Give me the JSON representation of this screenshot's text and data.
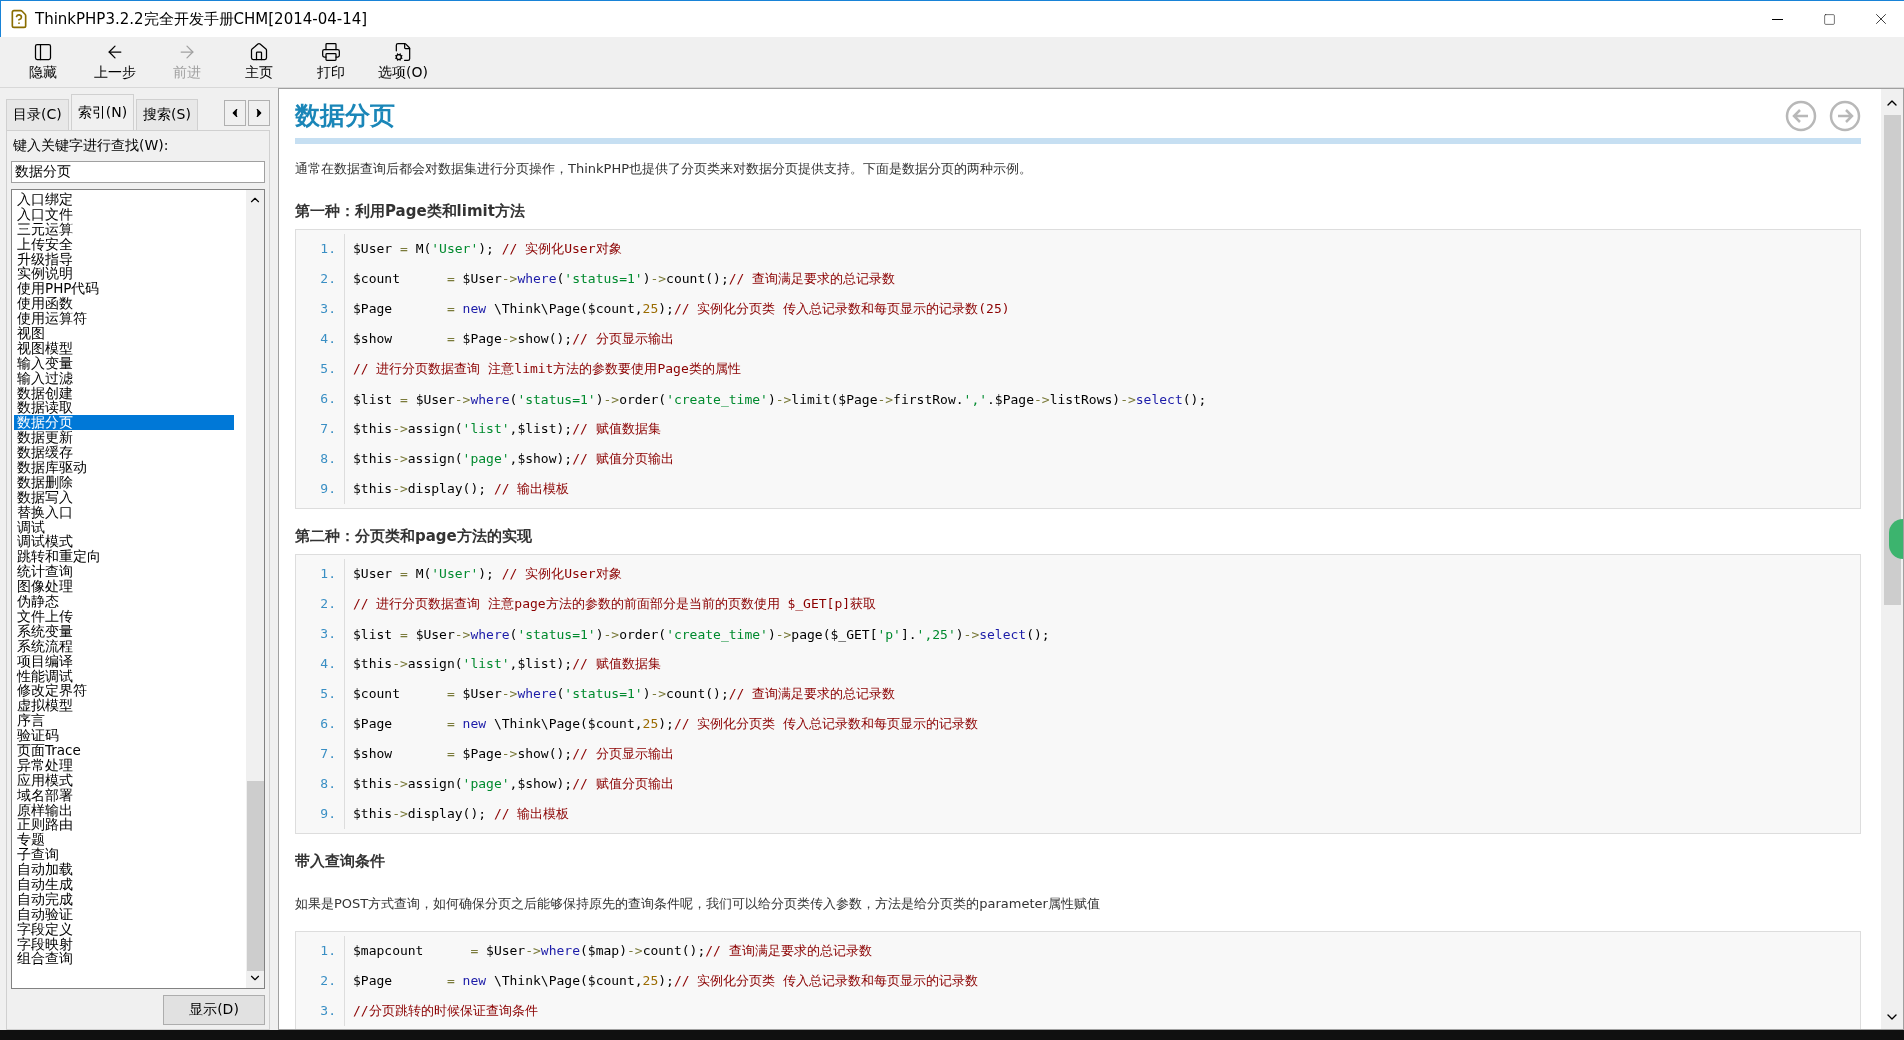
{
  "window": {
    "title": "ThinkPHP3.2.2完全开发手册CHM[2014-04-14]"
  },
  "toolbar": [
    {
      "kind": "hide",
      "label": "隐藏",
      "disabled": false
    },
    {
      "kind": "back",
      "label": "上一步",
      "disabled": false
    },
    {
      "kind": "forward",
      "label": "前进",
      "disabled": true
    },
    {
      "kind": "home",
      "label": "主页",
      "disabled": false
    },
    {
      "kind": "print",
      "label": "打印",
      "disabled": false
    },
    {
      "kind": "options",
      "label": "选项(O)",
      "disabled": false
    }
  ],
  "nav_tabs": [
    {
      "label": "目录(C)",
      "selected": false
    },
    {
      "label": "索引(N)",
      "selected": true
    },
    {
      "label": "搜索(S)",
      "selected": false
    }
  ],
  "index": {
    "prompt": "键入关键字进行查找(W):",
    "value": "数据分页",
    "items": [
      {
        "label": "入口绑定",
        "selected": false
      },
      {
        "label": "入口文件",
        "selected": false
      },
      {
        "label": "三元运算",
        "selected": false
      },
      {
        "label": "上传安全",
        "selected": false
      },
      {
        "label": "升级指导",
        "selected": false
      },
      {
        "label": "实例说明",
        "selected": false
      },
      {
        "label": "使用PHP代码",
        "selected": false
      },
      {
        "label": "使用函数",
        "selected": false
      },
      {
        "label": "使用运算符",
        "selected": false
      },
      {
        "label": "视图",
        "selected": false
      },
      {
        "label": "视图模型",
        "selected": false
      },
      {
        "label": "输入变量",
        "selected": false
      },
      {
        "label": "输入过滤",
        "selected": false
      },
      {
        "label": "数据创建",
        "selected": false
      },
      {
        "label": "数据读取",
        "selected": false
      },
      {
        "label": "数据分页",
        "selected": true
      },
      {
        "label": "数据更新",
        "selected": false
      },
      {
        "label": "数据缓存",
        "selected": false
      },
      {
        "label": "数据库驱动",
        "selected": false
      },
      {
        "label": "数据删除",
        "selected": false
      },
      {
        "label": "数据写入",
        "selected": false
      },
      {
        "label": "替换入口",
        "selected": false
      },
      {
        "label": "调试",
        "selected": false
      },
      {
        "label": "调试模式",
        "selected": false
      },
      {
        "label": "跳转和重定向",
        "selected": false
      },
      {
        "label": "统计查询",
        "selected": false
      },
      {
        "label": "图像处理",
        "selected": false
      },
      {
        "label": "伪静态",
        "selected": false
      },
      {
        "label": "文件上传",
        "selected": false
      },
      {
        "label": "系统变量",
        "selected": false
      },
      {
        "label": "系统流程",
        "selected": false
      },
      {
        "label": "项目编译",
        "selected": false
      },
      {
        "label": "性能调试",
        "selected": false
      },
      {
        "label": "修改定界符",
        "selected": false
      },
      {
        "label": "虚拟模型",
        "selected": false
      },
      {
        "label": "序言",
        "selected": false
      },
      {
        "label": "验证码",
        "selected": false
      },
      {
        "label": "页面Trace",
        "selected": false
      },
      {
        "label": "异常处理",
        "selected": false
      },
      {
        "label": "应用模式",
        "selected": false
      },
      {
        "label": "域名部署",
        "selected": false
      },
      {
        "label": "原样输出",
        "selected": false
      },
      {
        "label": "正则路由",
        "selected": false
      },
      {
        "label": "专题",
        "selected": false
      },
      {
        "label": "子查询",
        "selected": false
      },
      {
        "label": "自动加载",
        "selected": false
      },
      {
        "label": "自动生成",
        "selected": false
      },
      {
        "label": "自动完成",
        "selected": false
      },
      {
        "label": "自动验证",
        "selected": false
      },
      {
        "label": "字段定义",
        "selected": false
      },
      {
        "label": "字段映射",
        "selected": false
      },
      {
        "label": "组合查询",
        "selected": false
      }
    ],
    "button": "显示(D)"
  },
  "article": {
    "title": "数据分页",
    "blocks": [
      {
        "kind": "para",
        "text": "通常在数据查询后都会对数据集进行分页操作，ThinkPHP也提供了分页类来对数据分页提供支持。下面是数据分页的两种示例。"
      },
      {
        "kind": "heading",
        "text": "第一种：利用Page类和limit方法"
      },
      {
        "kind": "code",
        "lines": [
          {
            "n": "1.",
            "tokens": [
              {
                "kind": "p",
                "text": "$User "
              },
              {
                "kind": "o",
                "text": "= "
              },
              {
                "kind": "p",
                "text": "M("
              },
              {
                "kind": "s",
                "text": "'User'"
              },
              {
                "kind": "p",
                "text": "); "
              },
              {
                "kind": "c",
                "text": "// 实例化User对象"
              }
            ]
          },
          {
            "n": "2.",
            "tokens": [
              {
                "kind": "p",
                "text": "$count      "
              },
              {
                "kind": "o",
                "text": "= "
              },
              {
                "kind": "p",
                "text": "$User"
              },
              {
                "kind": "o",
                "text": "->"
              },
              {
                "kind": "k",
                "text": "where"
              },
              {
                "kind": "p",
                "text": "("
              },
              {
                "kind": "s",
                "text": "'status=1'"
              },
              {
                "kind": "p",
                "text": ")"
              },
              {
                "kind": "o",
                "text": "->"
              },
              {
                "kind": "p",
                "text": "count();"
              },
              {
                "kind": "c",
                "text": "// 查询满足要求的总记录数"
              }
            ]
          },
          {
            "n": "3.",
            "tokens": [
              {
                "kind": "p",
                "text": "$Page       "
              },
              {
                "kind": "o",
                "text": "= "
              },
              {
                "kind": "k",
                "text": "new"
              },
              {
                "kind": "p",
                "text": " \\Think\\Page($count,"
              },
              {
                "kind": "n",
                "text": "25"
              },
              {
                "kind": "p",
                "text": ");"
              },
              {
                "kind": "c",
                "text": "// 实例化分页类 传入总记录数和每页显示的记录数(25)"
              }
            ]
          },
          {
            "n": "4.",
            "tokens": [
              {
                "kind": "p",
                "text": "$show       "
              },
              {
                "kind": "o",
                "text": "= "
              },
              {
                "kind": "p",
                "text": "$Page"
              },
              {
                "kind": "o",
                "text": "->"
              },
              {
                "kind": "p",
                "text": "show();"
              },
              {
                "kind": "c",
                "text": "// 分页显示输出"
              }
            ]
          },
          {
            "n": "5.",
            "tokens": [
              {
                "kind": "c",
                "text": "// 进行分页数据查询 注意limit方法的参数要使用Page类的属性"
              }
            ]
          },
          {
            "n": "6.",
            "tokens": [
              {
                "kind": "p",
                "text": "$list "
              },
              {
                "kind": "o",
                "text": "= "
              },
              {
                "kind": "p",
                "text": "$User"
              },
              {
                "kind": "o",
                "text": "->"
              },
              {
                "kind": "k",
                "text": "where"
              },
              {
                "kind": "p",
                "text": "("
              },
              {
                "kind": "s",
                "text": "'status=1'"
              },
              {
                "kind": "p",
                "text": ")"
              },
              {
                "kind": "o",
                "text": "->"
              },
              {
                "kind": "p",
                "text": "order("
              },
              {
                "kind": "s",
                "text": "'create_time'"
              },
              {
                "kind": "p",
                "text": ")"
              },
              {
                "kind": "o",
                "text": "->"
              },
              {
                "kind": "p",
                "text": "limit($Page"
              },
              {
                "kind": "o",
                "text": "->"
              },
              {
                "kind": "p",
                "text": "firstRow."
              },
              {
                "kind": "s",
                "text": "','"
              },
              {
                "kind": "p",
                "text": ".$Page"
              },
              {
                "kind": "o",
                "text": "->"
              },
              {
                "kind": "p",
                "text": "listRows)"
              },
              {
                "kind": "o",
                "text": "->"
              },
              {
                "kind": "k",
                "text": "select"
              },
              {
                "kind": "p",
                "text": "();"
              }
            ]
          },
          {
            "n": "7.",
            "tokens": [
              {
                "kind": "p",
                "text": "$this"
              },
              {
                "kind": "o",
                "text": "->"
              },
              {
                "kind": "p",
                "text": "assign("
              },
              {
                "kind": "s",
                "text": "'list'"
              },
              {
                "kind": "p",
                "text": ",$list);"
              },
              {
                "kind": "c",
                "text": "// 赋值数据集"
              }
            ]
          },
          {
            "n": "8.",
            "tokens": [
              {
                "kind": "p",
                "text": "$this"
              },
              {
                "kind": "o",
                "text": "->"
              },
              {
                "kind": "p",
                "text": "assign("
              },
              {
                "kind": "s",
                "text": "'page'"
              },
              {
                "kind": "p",
                "text": ",$show);"
              },
              {
                "kind": "c",
                "text": "// 赋值分页输出"
              }
            ]
          },
          {
            "n": "9.",
            "tokens": [
              {
                "kind": "p",
                "text": "$this"
              },
              {
                "kind": "o",
                "text": "->"
              },
              {
                "kind": "p",
                "text": "display(); "
              },
              {
                "kind": "c",
                "text": "// 输出模板"
              }
            ]
          }
        ]
      },
      {
        "kind": "heading",
        "text": "第二种：分页类和page方法的实现"
      },
      {
        "kind": "code",
        "lines": [
          {
            "n": "1.",
            "tokens": [
              {
                "kind": "p",
                "text": "$User "
              },
              {
                "kind": "o",
                "text": "= "
              },
              {
                "kind": "p",
                "text": "M("
              },
              {
                "kind": "s",
                "text": "'User'"
              },
              {
                "kind": "p",
                "text": "); "
              },
              {
                "kind": "c",
                "text": "// 实例化User对象"
              }
            ]
          },
          {
            "n": "2.",
            "tokens": [
              {
                "kind": "c",
                "text": "// 进行分页数据查询 注意page方法的参数的前面部分是当前的页数使用 $_GET[p]获取"
              }
            ]
          },
          {
            "n": "3.",
            "tokens": [
              {
                "kind": "p",
                "text": "$list "
              },
              {
                "kind": "o",
                "text": "= "
              },
              {
                "kind": "p",
                "text": "$User"
              },
              {
                "kind": "o",
                "text": "->"
              },
              {
                "kind": "k",
                "text": "where"
              },
              {
                "kind": "p",
                "text": "("
              },
              {
                "kind": "s",
                "text": "'status=1'"
              },
              {
                "kind": "p",
                "text": ")"
              },
              {
                "kind": "o",
                "text": "->"
              },
              {
                "kind": "p",
                "text": "order("
              },
              {
                "kind": "s",
                "text": "'create_time'"
              },
              {
                "kind": "p",
                "text": ")"
              },
              {
                "kind": "o",
                "text": "->"
              },
              {
                "kind": "p",
                "text": "page($_GET["
              },
              {
                "kind": "s",
                "text": "'p'"
              },
              {
                "kind": "p",
                "text": "]."
              },
              {
                "kind": "s",
                "text": "',25'"
              },
              {
                "kind": "p",
                "text": ")"
              },
              {
                "kind": "o",
                "text": "->"
              },
              {
                "kind": "k",
                "text": "select"
              },
              {
                "kind": "p",
                "text": "();"
              }
            ]
          },
          {
            "n": "4.",
            "tokens": [
              {
                "kind": "p",
                "text": "$this"
              },
              {
                "kind": "o",
                "text": "->"
              },
              {
                "kind": "p",
                "text": "assign("
              },
              {
                "kind": "s",
                "text": "'list'"
              },
              {
                "kind": "p",
                "text": ",$list);"
              },
              {
                "kind": "c",
                "text": "// 赋值数据集"
              }
            ]
          },
          {
            "n": "5.",
            "tokens": [
              {
                "kind": "p",
                "text": "$count      "
              },
              {
                "kind": "o",
                "text": "= "
              },
              {
                "kind": "p",
                "text": "$User"
              },
              {
                "kind": "o",
                "text": "->"
              },
              {
                "kind": "k",
                "text": "where"
              },
              {
                "kind": "p",
                "text": "("
              },
              {
                "kind": "s",
                "text": "'status=1'"
              },
              {
                "kind": "p",
                "text": ")"
              },
              {
                "kind": "o",
                "text": "->"
              },
              {
                "kind": "p",
                "text": "count();"
              },
              {
                "kind": "c",
                "text": "// 查询满足要求的总记录数"
              }
            ]
          },
          {
            "n": "6.",
            "tokens": [
              {
                "kind": "p",
                "text": "$Page       "
              },
              {
                "kind": "o",
                "text": "= "
              },
              {
                "kind": "k",
                "text": "new"
              },
              {
                "kind": "p",
                "text": " \\Think\\Page($count,"
              },
              {
                "kind": "n",
                "text": "25"
              },
              {
                "kind": "p",
                "text": ");"
              },
              {
                "kind": "c",
                "text": "// 实例化分页类 传入总记录数和每页显示的记录数"
              }
            ]
          },
          {
            "n": "7.",
            "tokens": [
              {
                "kind": "p",
                "text": "$show       "
              },
              {
                "kind": "o",
                "text": "= "
              },
              {
                "kind": "p",
                "text": "$Page"
              },
              {
                "kind": "o",
                "text": "->"
              },
              {
                "kind": "p",
                "text": "show();"
              },
              {
                "kind": "c",
                "text": "// 分页显示输出"
              }
            ]
          },
          {
            "n": "8.",
            "tokens": [
              {
                "kind": "p",
                "text": "$this"
              },
              {
                "kind": "o",
                "text": "->"
              },
              {
                "kind": "p",
                "text": "assign("
              },
              {
                "kind": "s",
                "text": "'page'"
              },
              {
                "kind": "p",
                "text": ",$show);"
              },
              {
                "kind": "c",
                "text": "// 赋值分页输出"
              }
            ]
          },
          {
            "n": "9.",
            "tokens": [
              {
                "kind": "p",
                "text": "$this"
              },
              {
                "kind": "o",
                "text": "->"
              },
              {
                "kind": "p",
                "text": "display(); "
              },
              {
                "kind": "c",
                "text": "// 输出模板"
              }
            ]
          }
        ]
      },
      {
        "kind": "heading",
        "text": "带入查询条件"
      },
      {
        "kind": "para",
        "text": "如果是POST方式查询，如何确保分页之后能够保持原先的查询条件呢，我们可以给分页类传入参数，方法是给分页类的parameter属性赋值"
      },
      {
        "kind": "code",
        "lines": [
          {
            "n": "1.",
            "tokens": [
              {
                "kind": "p",
                "text": "$mapcount      "
              },
              {
                "kind": "o",
                "text": "= "
              },
              {
                "kind": "p",
                "text": "$User"
              },
              {
                "kind": "o",
                "text": "->"
              },
              {
                "kind": "k",
                "text": "where"
              },
              {
                "kind": "p",
                "text": "($map)"
              },
              {
                "kind": "o",
                "text": "->"
              },
              {
                "kind": "p",
                "text": "count();"
              },
              {
                "kind": "c",
                "text": "// 查询满足要求的总记录数"
              }
            ]
          },
          {
            "n": "2.",
            "tokens": [
              {
                "kind": "p",
                "text": "$Page       "
              },
              {
                "kind": "o",
                "text": "= "
              },
              {
                "kind": "k",
                "text": "new"
              },
              {
                "kind": "p",
                "text": " \\Think\\Page($count,"
              },
              {
                "kind": "n",
                "text": "25"
              },
              {
                "kind": "p",
                "text": ");"
              },
              {
                "kind": "c",
                "text": "// 实例化分页类 传入总记录数和每页显示的记录数"
              }
            ]
          },
          {
            "n": "3.",
            "tokens": [
              {
                "kind": "c",
                "text": "//分页跳转的时候保证查询条件"
              }
            ]
          }
        ]
      }
    ]
  }
}
